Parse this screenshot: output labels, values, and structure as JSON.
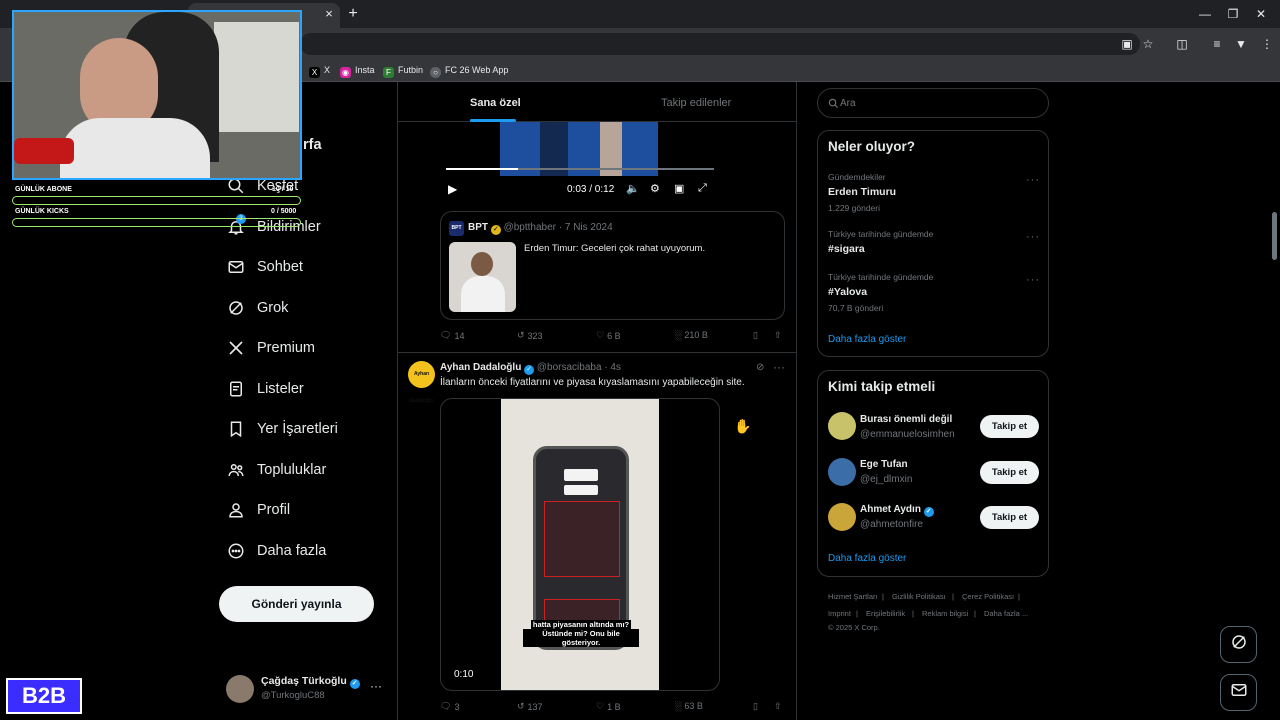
{
  "browser": {
    "tab_close": "×",
    "new_tab": "+",
    "bookmarks": [
      {
        "label": "X",
        "icon": "x-logo-icon"
      },
      {
        "label": "Insta",
        "icon": "instagram-icon"
      },
      {
        "label": "Futbin",
        "icon": "futbin-icon"
      },
      {
        "label": "FC 26 Web App",
        "icon": "globe-icon"
      }
    ]
  },
  "overlay": {
    "subs_label": "GÜNLÜK ABONE",
    "subs_value": "10 / 10",
    "kicks_label": "GÜNLÜK KICKS",
    "kicks_value": "0 / 5000",
    "badge": "B2B"
  },
  "sidebar": {
    "partial_item": "rfa",
    "items": [
      {
        "label": "Keşfet",
        "icon": "search-icon"
      },
      {
        "label": "Bildirimler",
        "icon": "bell-icon"
      },
      {
        "label": "Sohbet",
        "icon": "mail-icon"
      },
      {
        "label": "Grok",
        "icon": "grok-icon"
      },
      {
        "label": "Premium",
        "icon": "x-logo-icon"
      },
      {
        "label": "Listeler",
        "icon": "list-icon"
      },
      {
        "label": "Yer İşaretleri",
        "icon": "bookmark-icon"
      },
      {
        "label": "Topluluklar",
        "icon": "people-icon"
      },
      {
        "label": "Profil",
        "icon": "person-icon"
      },
      {
        "label": "Daha fazla",
        "icon": "more-circle-icon"
      }
    ],
    "post_button": "Gönderi yayınla",
    "notif_badge": "3",
    "account": {
      "name": "Çağdaş Türkoğlu",
      "handle": "@TurkogluC88",
      "more": "···"
    }
  },
  "feed": {
    "tabs": [
      "Sana özel",
      "Takip edilenler"
    ],
    "video1": {
      "time": "0:03 / 0:12",
      "progress": 0.27
    },
    "quote": {
      "author": "BPT",
      "handle": "@bptthaber",
      "date": "· 7 Nis 2024",
      "text": "Erden Timur: Geceleri çok rahat uyuyorum."
    },
    "actions1": {
      "replies": "14",
      "reposts": "323",
      "likes": "6 B",
      "views": "210 B"
    },
    "post2": {
      "author": "Ayhan Dadaloğlu",
      "handle": "@borsacibaba",
      "time": "· 4s",
      "text": "İlanların önceki fiyatlarını ve piyasa kıyaslamasını yapabileceğin site.",
      "video_time": "0:10",
      "caption_line1": "hatta piyasanın altında mı?",
      "caption_line2": "Üstünde mi? Onu bile gösteriyor.",
      "avatar_text": "Ayhan Dadaloğlu"
    },
    "actions2": {
      "replies": "3",
      "reposts": "137",
      "likes": "1 B",
      "views": "63 B"
    }
  },
  "right": {
    "search_placeholder": "Ara",
    "trends_title": "Neler oluyor?",
    "trends": [
      {
        "context": "Gündemdekiler",
        "name": "Erden Timuru",
        "count": "1.229 gönderi"
      },
      {
        "context": "Türkiye tarihinde gündemde",
        "name": "#sigara",
        "count": ""
      },
      {
        "context": "Türkiye tarihinde gündemde",
        "name": "#Yalova",
        "count": "70,7 B gönderi"
      }
    ],
    "trends_more": "Daha fazla göster",
    "who_title": "Kimi takip etmeli",
    "who": [
      {
        "name": "Burası önemli değil",
        "handle": "@emmanuelosimhen",
        "verified": false
      },
      {
        "name": "Ege Tufan",
        "handle": "@ej_dlmxin",
        "verified": false
      },
      {
        "name": "Ahmet Aydın",
        "handle": "@ahmetonfire",
        "verified": true
      }
    ],
    "follow_label": "Takip et",
    "who_more": "Daha fazla göster",
    "footer": [
      "Hizmet Şartları",
      "|",
      "Gizlilik Politikası",
      "|",
      "Çerez Politikası",
      "|",
      "Imprint",
      "|",
      "Erişilebilirlik",
      "|",
      "Reklam bilgisi",
      "|",
      "Daha fazla ...",
      "© 2025 X Corp."
    ]
  }
}
